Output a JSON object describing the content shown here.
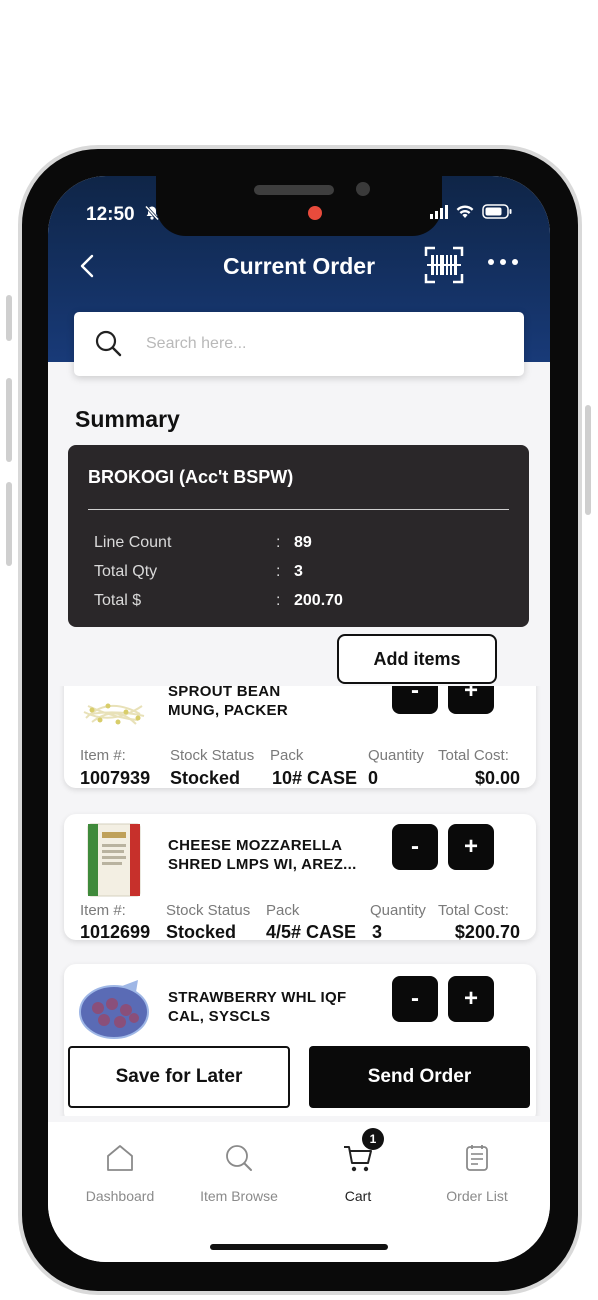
{
  "status_bar": {
    "time": "12:50"
  },
  "header": {
    "title": "Current Order"
  },
  "search": {
    "placeholder": "Search here..."
  },
  "summary": {
    "heading": "Summary",
    "account": "BROKOGI (Acc't BSPW)",
    "rows": [
      {
        "label": "Line Count",
        "value": "89"
      },
      {
        "label": "Total Qty",
        "value": "3"
      },
      {
        "label": "Total $",
        "value": "200.70"
      }
    ]
  },
  "add_items_label": "Add items",
  "labels": {
    "item_no": "Item #:",
    "stock_status": "Stock Status",
    "pack": "Pack",
    "quantity": "Quantity",
    "total_cost": "Total Cost:",
    "minus": "-",
    "plus": "+"
  },
  "items": [
    {
      "name1": "SPROUT BEAN",
      "name2": "MUNG, PACKER",
      "item_no": "1007939",
      "stock_status": "Stocked",
      "pack": "10# CASE",
      "quantity": "0",
      "total_cost": "$0.00"
    },
    {
      "name1": "CHEESE MOZZARELLA",
      "name2": "SHRED LMPS WI, AREZ...",
      "item_no": "1012699",
      "stock_status": "Stocked",
      "pack": "4/5# CASE",
      "quantity": "3",
      "total_cost": "$200.70"
    },
    {
      "name1": "STRAWBERRY WHL IQF",
      "name2": "CAL, SYSCLS"
    }
  ],
  "actions": {
    "save_for_later": "Save for Later",
    "send_order": "Send Order"
  },
  "tabs": [
    {
      "label": "Dashboard"
    },
    {
      "label": "Item Browse"
    },
    {
      "label": "Cart",
      "badge": "1"
    },
    {
      "label": "Order List"
    }
  ],
  "colors": {
    "header_top": "#0f2547",
    "header_bottom": "#183a78",
    "card_bg": "#2a2729",
    "button_dark": "#0a0a0a"
  }
}
